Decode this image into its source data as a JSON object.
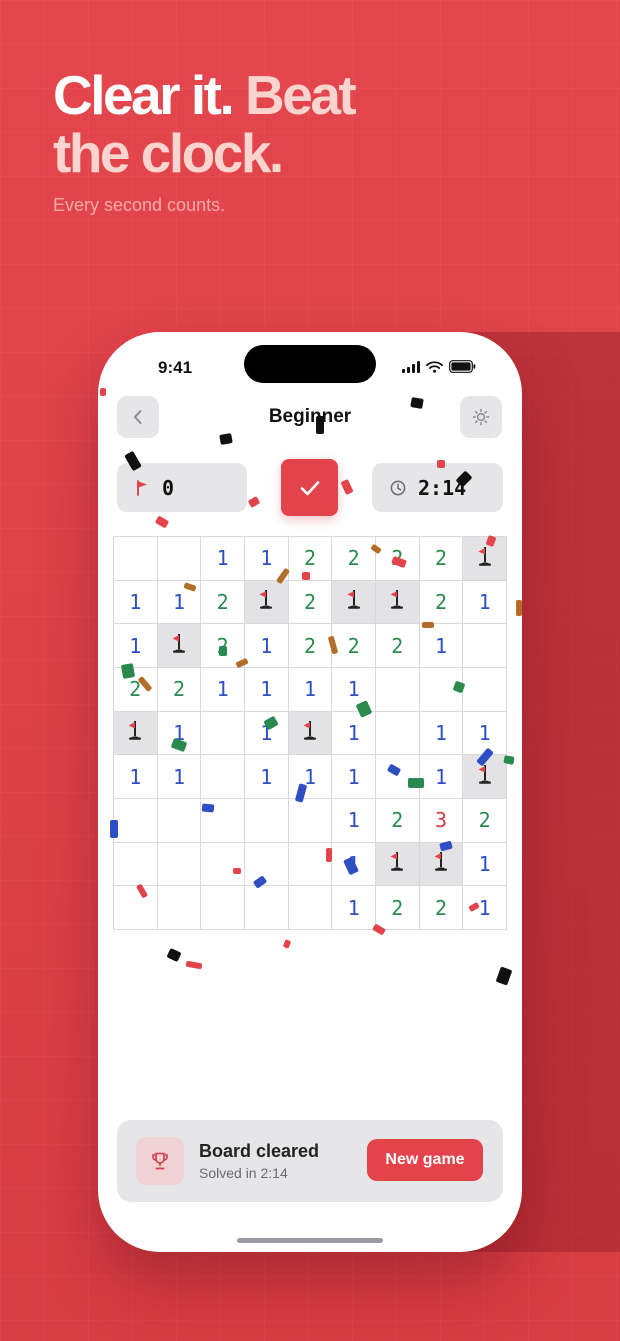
{
  "promo": {
    "headline_white": "Clear it.",
    "headline_light_1": "Beat",
    "headline_light_2": "the clock.",
    "subheadline": "Every second counts."
  },
  "status_bar": {
    "time": "9:41"
  },
  "nav": {
    "title": "Beginner",
    "back_icon": "chevron-left-icon",
    "settings_icon": "sun-gear-icon"
  },
  "counters": {
    "flags": "0",
    "timer": "2:14",
    "face_icon": "checkmark-icon"
  },
  "colors": {
    "accent": "#e3444b",
    "one": "#2e4fc4",
    "two": "#2a8a4e",
    "three": "#d23b3b"
  },
  "board": {
    "rows": [
      [
        "",
        "",
        "1",
        "1",
        "2",
        "2",
        "2",
        "2",
        "F"
      ],
      [
        "1",
        "1",
        "2",
        "F",
        "2",
        "F",
        "F",
        "2",
        "1"
      ],
      [
        "1",
        "F",
        "2",
        "1",
        "2",
        "2",
        "2",
        "1",
        ""
      ],
      [
        "2",
        "2",
        "1",
        "1",
        "1",
        "1",
        "",
        "",
        ""
      ],
      [
        "F",
        "1",
        "",
        "1",
        "F",
        "1",
        "",
        "1",
        "1"
      ],
      [
        "1",
        "1",
        "",
        "1",
        "1",
        "1",
        "",
        "1",
        "F"
      ],
      [
        "",
        "",
        "",
        "",
        "",
        "1",
        "2",
        "3",
        "2"
      ],
      [
        "",
        "",
        "",
        "",
        "",
        "1",
        "F",
        "F",
        "1"
      ],
      [
        "",
        "",
        "",
        "",
        "",
        "1",
        "2",
        "2",
        "1"
      ]
    ]
  },
  "banner": {
    "title": "Board cleared",
    "subtitle": "Solved in 2:14",
    "button": "New game",
    "icon": "trophy-icon"
  }
}
